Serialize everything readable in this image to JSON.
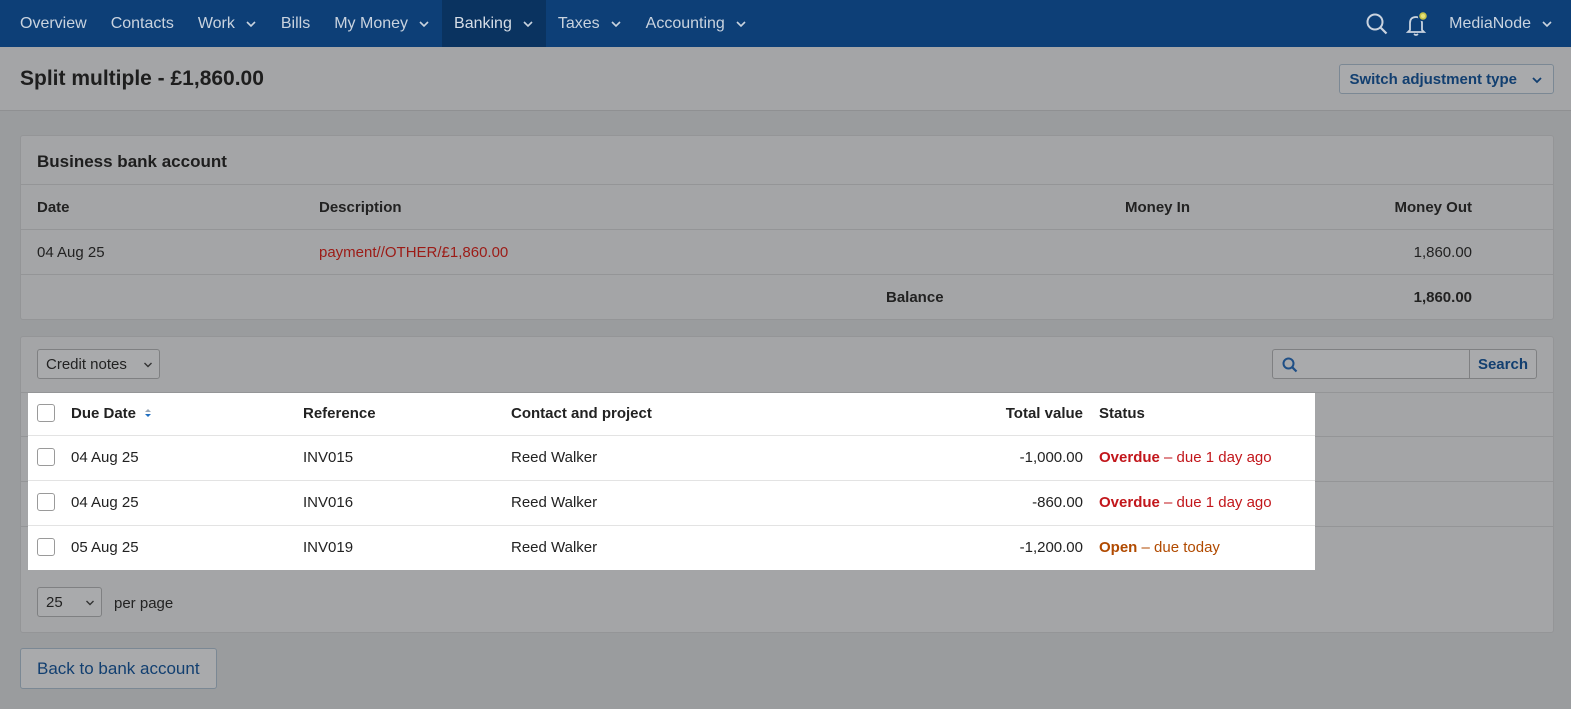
{
  "nav": {
    "items": [
      {
        "label": "Overview",
        "has_dropdown": false,
        "active": false
      },
      {
        "label": "Contacts",
        "has_dropdown": false,
        "active": false
      },
      {
        "label": "Work",
        "has_dropdown": true,
        "active": false
      },
      {
        "label": "Bills",
        "has_dropdown": false,
        "active": false
      },
      {
        "label": "My Money",
        "has_dropdown": true,
        "active": false
      },
      {
        "label": "Banking",
        "has_dropdown": true,
        "active": true
      },
      {
        "label": "Taxes",
        "has_dropdown": true,
        "active": false
      },
      {
        "label": "Accounting",
        "has_dropdown": true,
        "active": false
      }
    ],
    "account_name": "MediaNode",
    "icons": [
      "search-icon",
      "bell-icon",
      "chevron-down-icon"
    ]
  },
  "header": {
    "title": "Split multiple - £1,860.00",
    "switch_label": "Switch adjustment type"
  },
  "bank": {
    "title": "Business bank account",
    "columns": {
      "date": "Date",
      "description": "Description",
      "money_in": "Money In",
      "money_out": "Money Out"
    },
    "row": {
      "date": "04 Aug 25",
      "description": "payment//OTHER/£1,860.00",
      "money_in": "",
      "money_out": "1,860.00"
    },
    "balance_label": "Balance",
    "balance_value": "1,860.00"
  },
  "invoices": {
    "filter_value": "Credit notes",
    "search_placeholder": "",
    "search_label": "Search",
    "columns": {
      "due_date": "Due Date",
      "reference": "Reference",
      "contact": "Contact and project",
      "total": "Total value",
      "status": "Status"
    },
    "rows": [
      {
        "due_date": "04 Aug 25",
        "reference": "INV015",
        "contact": "Reed Walker",
        "total": "-1,000.00",
        "status_label": "Overdue",
        "status_detail": " – due 1 day ago",
        "status_type": "overdue"
      },
      {
        "due_date": "04 Aug 25",
        "reference": "INV016",
        "contact": "Reed Walker",
        "total": "-860.00",
        "status_label": "Overdue",
        "status_detail": " – due 1 day ago",
        "status_type": "overdue"
      },
      {
        "due_date": "05 Aug 25",
        "reference": "INV019",
        "contact": "Reed Walker",
        "total": "-1,200.00",
        "status_label": "Open",
        "status_detail": " – due today",
        "status_type": "open"
      }
    ],
    "per_page_value": "25",
    "per_page_label": "per page"
  },
  "footer": {
    "back_label": "Back to bank account"
  },
  "colors": {
    "nav_bg": "#0d3f77",
    "overdue": "#c2161b",
    "open": "#b14a00",
    "link": "#123f70"
  }
}
